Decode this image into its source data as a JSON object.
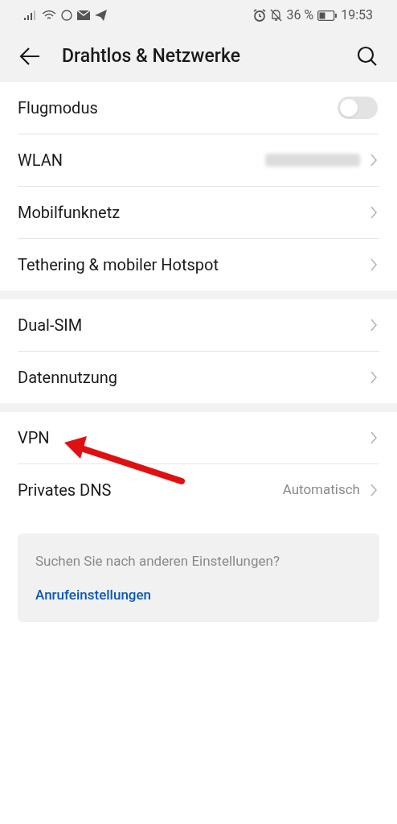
{
  "status_bar": {
    "battery": "36 %",
    "time": "19:53"
  },
  "header": {
    "title": "Drahtlos & Netzwerke"
  },
  "sections": [
    {
      "items": [
        {
          "kind": "toggle",
          "label": "Flugmodus",
          "on": false
        },
        {
          "kind": "blurred",
          "label": "WLAN"
        },
        {
          "kind": "link",
          "label": "Mobilfunknetz"
        },
        {
          "kind": "link",
          "label": "Tethering & mobiler Hotspot"
        }
      ]
    },
    {
      "items": [
        {
          "kind": "link",
          "label": "Dual-SIM"
        },
        {
          "kind": "link",
          "label": "Datennutzung"
        }
      ]
    },
    {
      "items": [
        {
          "kind": "link",
          "label": "VPN"
        },
        {
          "kind": "link",
          "label": "Privates DNS",
          "value": "Automatisch"
        }
      ]
    }
  ],
  "suggestion": {
    "question": "Suchen Sie nach anderen Einstellungen?",
    "link": "Anrufeinstellungen"
  }
}
